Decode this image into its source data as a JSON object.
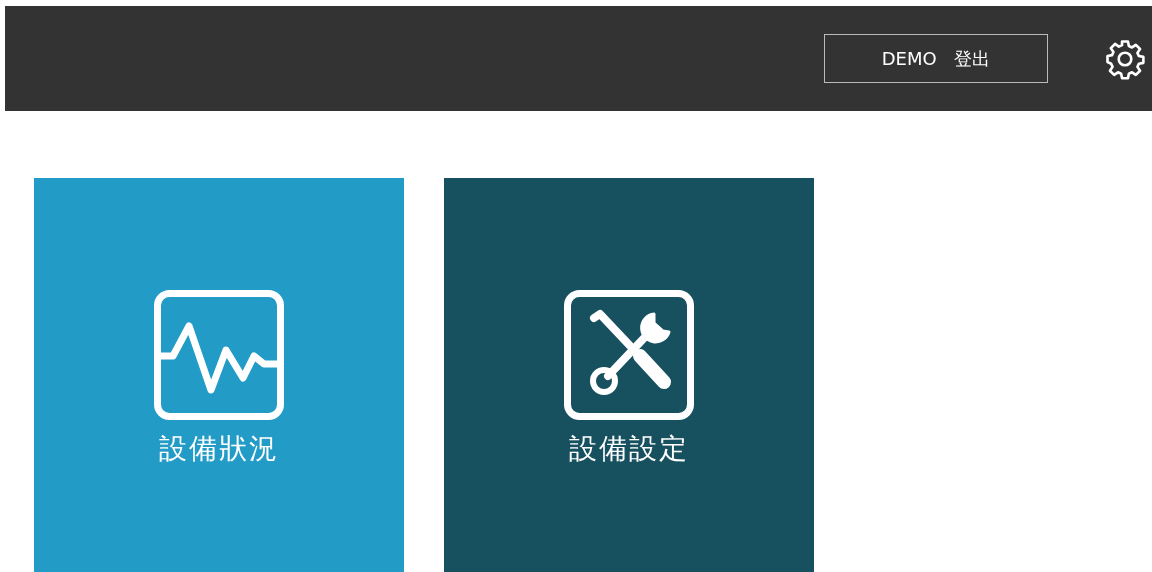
{
  "header": {
    "account_button": "DEMO 登出"
  },
  "tiles": [
    {
      "kind": "monitor",
      "label": "設備狀況",
      "color": "#239bc7"
    },
    {
      "kind": "tools",
      "label": "設備設定",
      "color": "#17505f"
    }
  ]
}
